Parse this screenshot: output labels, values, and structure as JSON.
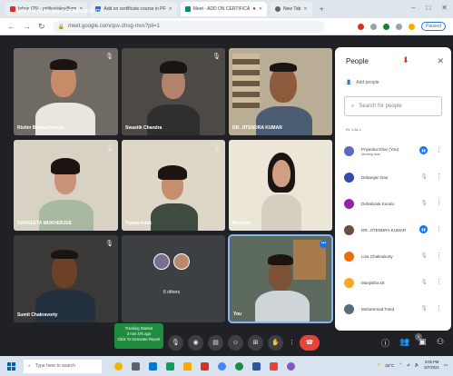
{
  "browser": {
    "tabs": [
      {
        "label": "Inbox (25) - pritikudaley@gm",
        "color": "#d93025",
        "active": false
      },
      {
        "label": "Add on certificate course in PF",
        "color": "#1a73e8",
        "active": false
      },
      {
        "label": "Meet - ADD ON CERTIFICA",
        "color": "#00897b",
        "active": true
      },
      {
        "label": "New Tab",
        "color": "#5f6368",
        "active": false
      }
    ],
    "new_tab": "+",
    "url": "meet.google.com/qsv-zhsg-mvs?pli=1",
    "pause_label": "Paused",
    "window_controls": [
      "–",
      "□",
      "✕"
    ]
  },
  "participants": [
    {
      "name": "Rishin Bhattacharyya",
      "skin": "#c68c68",
      "bg": "#6f6a63",
      "shirt": "#e9e5df"
    },
    {
      "name": "Swastik Chandra",
      "skin": "#b3826a",
      "bg": "#4d4a45",
      "shirt": "#2f2f2f"
    },
    {
      "name": "DR. JITENDRA KUMAR",
      "skin": "#8e5a3c",
      "bg": "#b9ad95",
      "shirt": "#4b5d73"
    },
    {
      "name": "SANGEETA MUKHERJEE",
      "skin": "#c9937a",
      "bg": "#d8d2c4",
      "shirt": "#a9b8a0"
    },
    {
      "name": "Tiyasa Adak",
      "skin": "#c58e6f",
      "bg": "#ded7c7",
      "shirt": "#3d4c3e"
    },
    {
      "name": "Navratra",
      "skin": "#cf9f83",
      "bg": "#ece6d8",
      "shirt": "#d4cfc1"
    },
    {
      "name": "Sumit Chakravorty",
      "skin": "#6c4128",
      "bg": "#3b3a39",
      "shirt": "#23313f"
    },
    {
      "name": "6 others",
      "skin": "#b8896d",
      "bg": "#3c4043",
      "shirt": "#7a6e8e"
    },
    {
      "name": "You",
      "skin": "#7d5136",
      "bg": "#5d6a5e",
      "shirt": "#cfd4d8"
    }
  ],
  "panel": {
    "title": "People",
    "close_icon": "✕",
    "add_people": "Add people",
    "search_placeholder": "Search for people",
    "section": "IN CALL",
    "people": [
      {
        "name": "Priyanka Dhar (You)",
        "sub": "Meeting host",
        "color": "#5c6bc0",
        "talking": true
      },
      {
        "name": "Debanjan Das",
        "sub": "",
        "color": "#3949ab",
        "talking": false
      },
      {
        "name": "Debabrata Kundu",
        "sub": "",
        "color": "#8e24aa",
        "talking": false
      },
      {
        "name": "DR. JITENDRA KUMAR",
        "sub": "",
        "color": "#6d4c41",
        "talking": true
      },
      {
        "name": "Liza Chakraborty",
        "sub": "",
        "color": "#ef6c00",
        "talking": false
      },
      {
        "name": "Manjistha Dt",
        "sub": "",
        "color": "#f9a825",
        "talking": false
      },
      {
        "name": "Mohammad Farid",
        "sub": "",
        "color": "#546e7a",
        "talking": false
      }
    ]
  },
  "meeting": {
    "info": "3:05 PM  |  ADD ON CERTIFICATE CO...",
    "tracking_line1": "Tracking Started",
    "tracking_line2": "3 min 37s ago",
    "tracking_line3": "Click To Generate Report",
    "participants_count": "3"
  },
  "taskbar": {
    "search_placeholder": "Type here to search",
    "weather": "34°C",
    "time": "3:05 PM",
    "date": "5/7/2021"
  }
}
